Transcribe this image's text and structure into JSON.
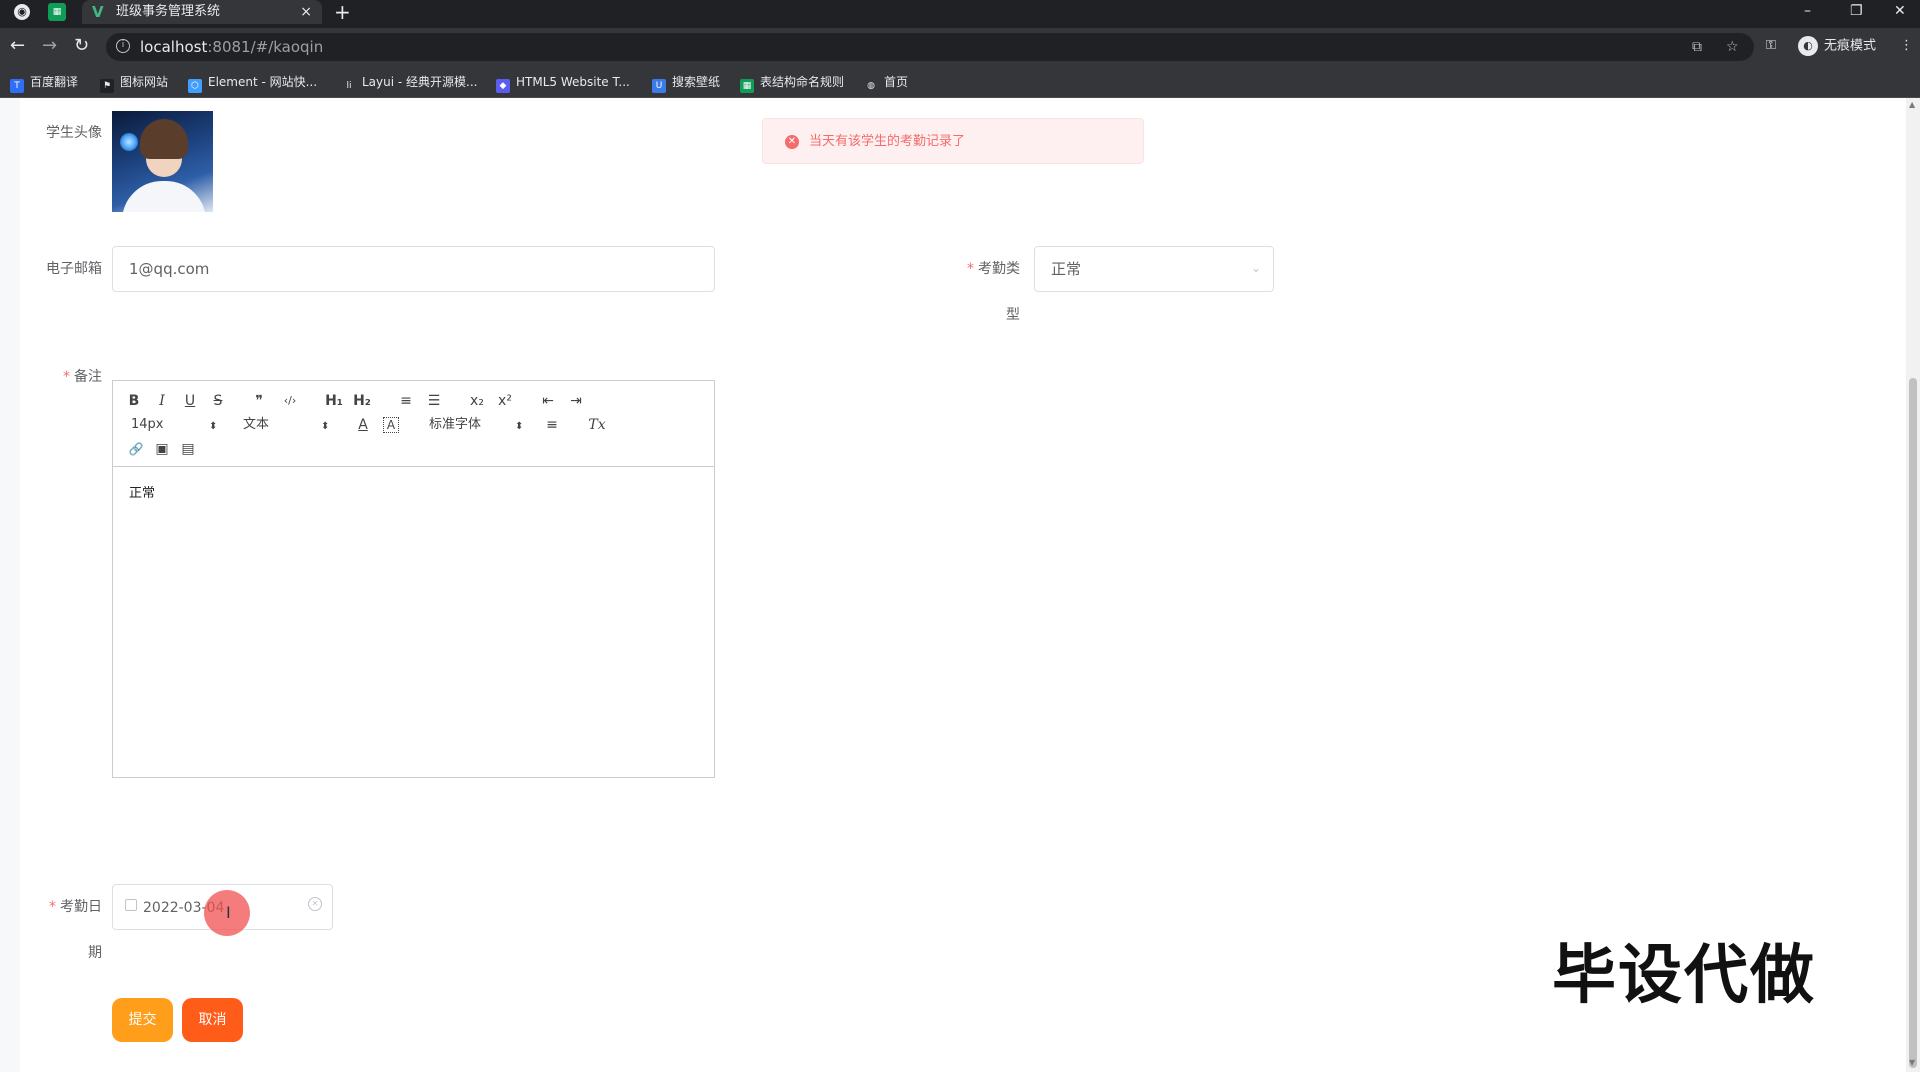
{
  "browser": {
    "tab_title": "班级事务管理系统",
    "tab_close": "×",
    "new_tab": "+",
    "url_host": "localhost",
    "url_rest": ":8081/#/kaoqin",
    "incognito_label": "无痕模式",
    "window_controls": [
      "–",
      "❐",
      "✕"
    ]
  },
  "bookmarks": [
    {
      "label": "百度翻译",
      "icon": "translate-icon",
      "color": "#2f6ff7"
    },
    {
      "label": "图标网站",
      "icon": "flag-icon",
      "color": "#202124"
    },
    {
      "label": "Element - 网站快...",
      "icon": "element-icon",
      "color": "#409eff"
    },
    {
      "label": "Layui - 经典开源模...",
      "icon": "layui-icon",
      "color": "#5fb878"
    },
    {
      "label": "HTML5 Website T...",
      "icon": "html5-icon",
      "color": "#5c5cf0"
    },
    {
      "label": "搜索壁纸",
      "icon": "wallpaper-icon",
      "color": "#3b7be8"
    },
    {
      "label": "表结构命名规则",
      "icon": "sheet-icon",
      "color": "#0f9d58"
    },
    {
      "label": "首页",
      "icon": "globe-icon",
      "color": "#202124"
    }
  ],
  "form": {
    "avatar_label": "学生头像",
    "email_label": "电子邮箱",
    "email_value": "1@qq.com",
    "attendance_type_label_1": "考勤类",
    "attendance_type_label_2": "型",
    "attendance_type_value": "正常",
    "remark_label": "备注",
    "remark_content": "正常",
    "date_label_1": "考勤日",
    "date_label_2": "期",
    "date_value": "2022-03-04",
    "required_mark": "*",
    "submit_label": "提交",
    "cancel_label": "取消"
  },
  "editor_toolbar": {
    "bold": "B",
    "italic": "I",
    "underline": "U",
    "strike": "S",
    "blockquote": "❞",
    "code": "‹/›",
    "h1": "H₁",
    "h2": "H₂",
    "ordered_list": "≡",
    "bullet_list": "☰",
    "subscript": "x₂",
    "superscript": "x²",
    "outdent": "⇤",
    "indent": "⇥",
    "size_value": "14px",
    "header_value": "文本",
    "font_value": "标准字体",
    "align": "≡",
    "clean": "Tx",
    "link": "🔗",
    "image": "▣",
    "video": "▤"
  },
  "alert": {
    "message": "当天有该学生的考勤记录了",
    "icon": "error-icon"
  },
  "watermark": "毕设代做",
  "colors": {
    "submit": "#ff9e1b",
    "cancel": "#ff5c1a",
    "error": "#f56c6c"
  }
}
